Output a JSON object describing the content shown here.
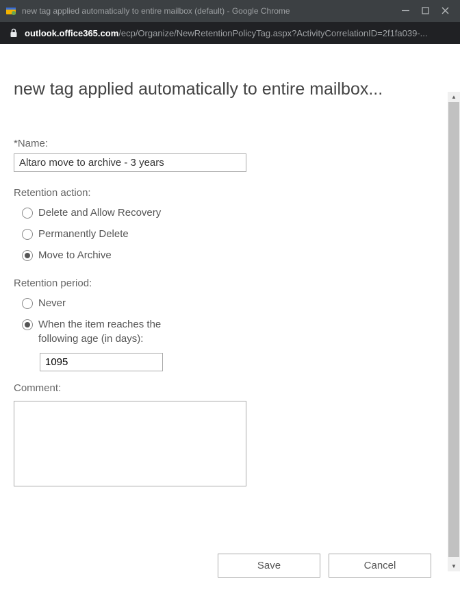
{
  "window": {
    "title": "new tag applied automatically to entire mailbox (default) - Google Chrome"
  },
  "url": {
    "domain": "outlook.office365.com",
    "path": "/ecp/Organize/NewRetentionPolicyTag.aspx?ActivityCorrelationID=2f1fa039-..."
  },
  "page": {
    "title": "new tag applied automatically to entire mailbox...",
    "nameLabel": "*Name:",
    "nameValue": "Altaro move to archive - 3 years",
    "retentionActionLabel": "Retention action:",
    "actions": {
      "deleteRecovery": "Delete and Allow Recovery",
      "permDelete": "Permanently Delete",
      "moveArchive": "Move to Archive"
    },
    "retentionPeriodLabel": "Retention period:",
    "periods": {
      "never": "Never",
      "whenAge": "When the item reaches the following age (in days):"
    },
    "daysValue": "1095",
    "commentLabel": "Comment:",
    "commentValue": "",
    "saveLabel": "Save",
    "cancelLabel": "Cancel"
  }
}
